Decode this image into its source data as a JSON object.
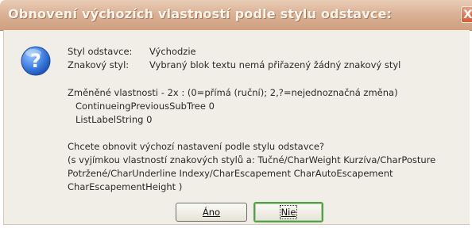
{
  "window": {
    "title": "Obnovení výchozích vlastností podle stylu odstavce:",
    "close_glyph": "X"
  },
  "message": {
    "icon": "question-icon",
    "paragraph_style_label": "Styl odstavce:",
    "paragraph_style_value": "Východzie",
    "char_style_label": "Znakový styl:",
    "char_style_value": "Vybraný blok textu nemá přiřazený žádný znakový styl",
    "changed_header": "Změněné vlastnosti - 2x : (0=přímá (ruční); 2,?=nejednoznačná změna)",
    "changed_items": [
      "ContinueingPreviousSubTree 0",
      "ListLabelString 0"
    ],
    "question_lines": [
      "Chcete obnovit výchozí nastavení podle stylu odstavce?",
      "(s vyjímkou vlastností znakových stylů a: Tučné/CharWeight Kurzíva/CharPosture",
      "Potržené/CharUnderline Indexy/CharEscapement CharAutoEscapement",
      "CharEscapementHeight )"
    ]
  },
  "buttons": {
    "yes_label": "Áno",
    "no_label": "Nie"
  },
  "colors": {
    "titlebar": "#dbb296",
    "client_bg": "#f0eee6",
    "focus_border": "#57a04b"
  }
}
